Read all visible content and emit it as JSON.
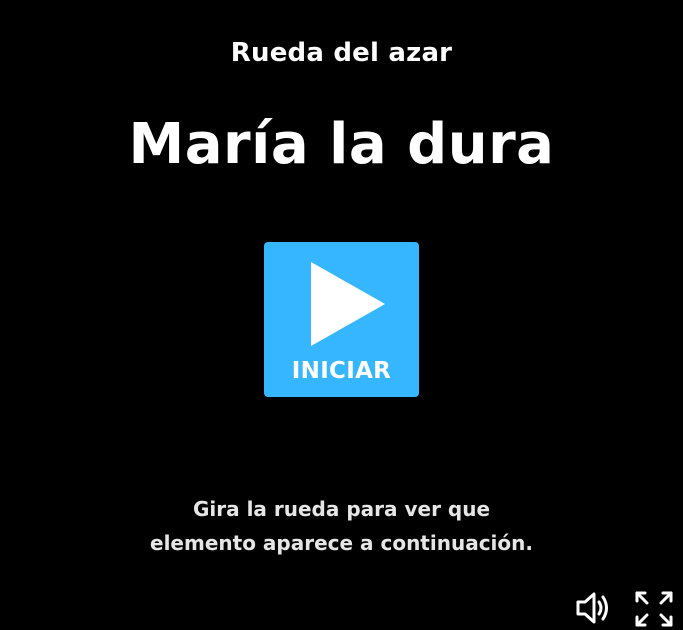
{
  "activity": {
    "type_label": "Rueda del azar",
    "title": "María la dura"
  },
  "start_button": {
    "label": "INICIAR",
    "color": "#35b6ff",
    "icon": "play-icon"
  },
  "instructions": {
    "line1": "Gira la rueda para ver que",
    "line2": "elemento aparece a continuación."
  },
  "controls": {
    "sound_icon": "speaker-icon",
    "fullscreen_icon": "fullscreen-icon"
  },
  "colors": {
    "background": "#000000",
    "text": "#ffffff",
    "accent": "#35b6ff"
  }
}
